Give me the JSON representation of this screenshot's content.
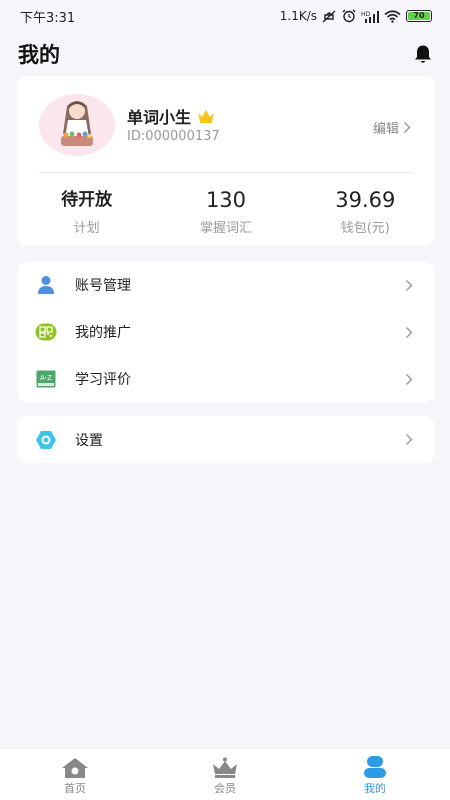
{
  "status_bar": {
    "time": "下午3:31",
    "net_speed": "1.1K/s",
    "battery": "70"
  },
  "header": {
    "title": "我的"
  },
  "profile": {
    "username": "单词小生",
    "user_id": "ID:000000137",
    "edit_label": "编辑"
  },
  "stats": [
    {
      "value": "待开放",
      "label": "计划"
    },
    {
      "value": "130",
      "label": "掌握词汇"
    },
    {
      "value": "39.69",
      "label": "钱包(元)"
    }
  ],
  "menu": [
    {
      "label": "账号管理",
      "icon": "user-icon"
    },
    {
      "label": "我的推广",
      "icon": "promotion-icon"
    },
    {
      "label": "学习评价",
      "icon": "az-book-icon"
    }
  ],
  "settings": {
    "label": "设置",
    "icon": "settings-icon"
  },
  "bottom_nav": [
    {
      "label": "首页",
      "icon": "home-icon"
    },
    {
      "label": "会员",
      "icon": "crown-icon"
    },
    {
      "label": "我的",
      "icon": "profile-icon",
      "active": true
    }
  ],
  "colors": {
    "accent": "#2f9be6",
    "background": "#f6f5f9",
    "crown": "#f5c518"
  }
}
